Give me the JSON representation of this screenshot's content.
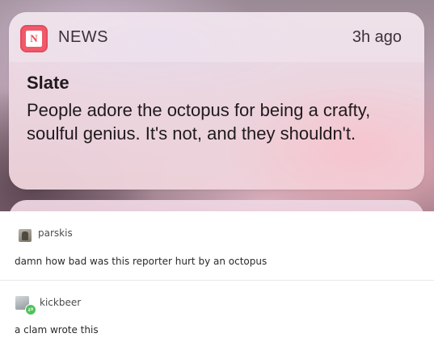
{
  "notification": {
    "app_name": "NEWS",
    "app_icon": "news-app-icon",
    "icon_glyph": "N",
    "time": "3h ago",
    "source": "Slate",
    "message": "People adore the octopus for being a crafty, soulful genius. It's not, and they shouldn't."
  },
  "comments": [
    {
      "username": "parskis",
      "text": "damn how bad was this reporter hurt by an octopus"
    },
    {
      "username": "kickbeer",
      "text": "a clam wrote this"
    }
  ],
  "colors": {
    "icon_red": "#f05a6b",
    "badge_green": "#4fc35b"
  }
}
